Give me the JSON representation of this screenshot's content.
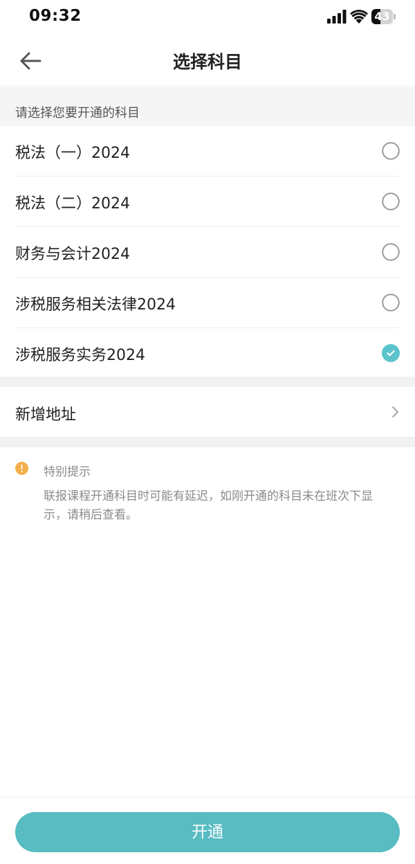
{
  "status_bar": {
    "time": "09:32",
    "battery_level": "43",
    "battery_fraction": 0.43
  },
  "header": {
    "title": "选择科目",
    "back_icon": "arrow-left-icon"
  },
  "section": {
    "hint": "请选择您要开通的科目"
  },
  "subjects": [
    {
      "label": "税法（一）2024",
      "selected": false
    },
    {
      "label": "税法（二）2024",
      "selected": false
    },
    {
      "label": "财务与会计2024",
      "selected": false
    },
    {
      "label": "涉税服务相关法律2024",
      "selected": false
    },
    {
      "label": "涉税服务实务2024",
      "selected": true
    }
  ],
  "address": {
    "label": "新增地址",
    "icon": "chevron-right-icon"
  },
  "notice": {
    "title": "特别提示",
    "body": "联报课程开通科目时可能有延迟，如刚开通的科目未在班次下显示，请稍后查看。",
    "icon": "info-icon"
  },
  "footer": {
    "button_label": "开通"
  },
  "colors": {
    "accent": "#58bcc2",
    "check": "#5ac3cc",
    "radio_border": "#9a9a9a",
    "warning": "#f4b04a"
  }
}
